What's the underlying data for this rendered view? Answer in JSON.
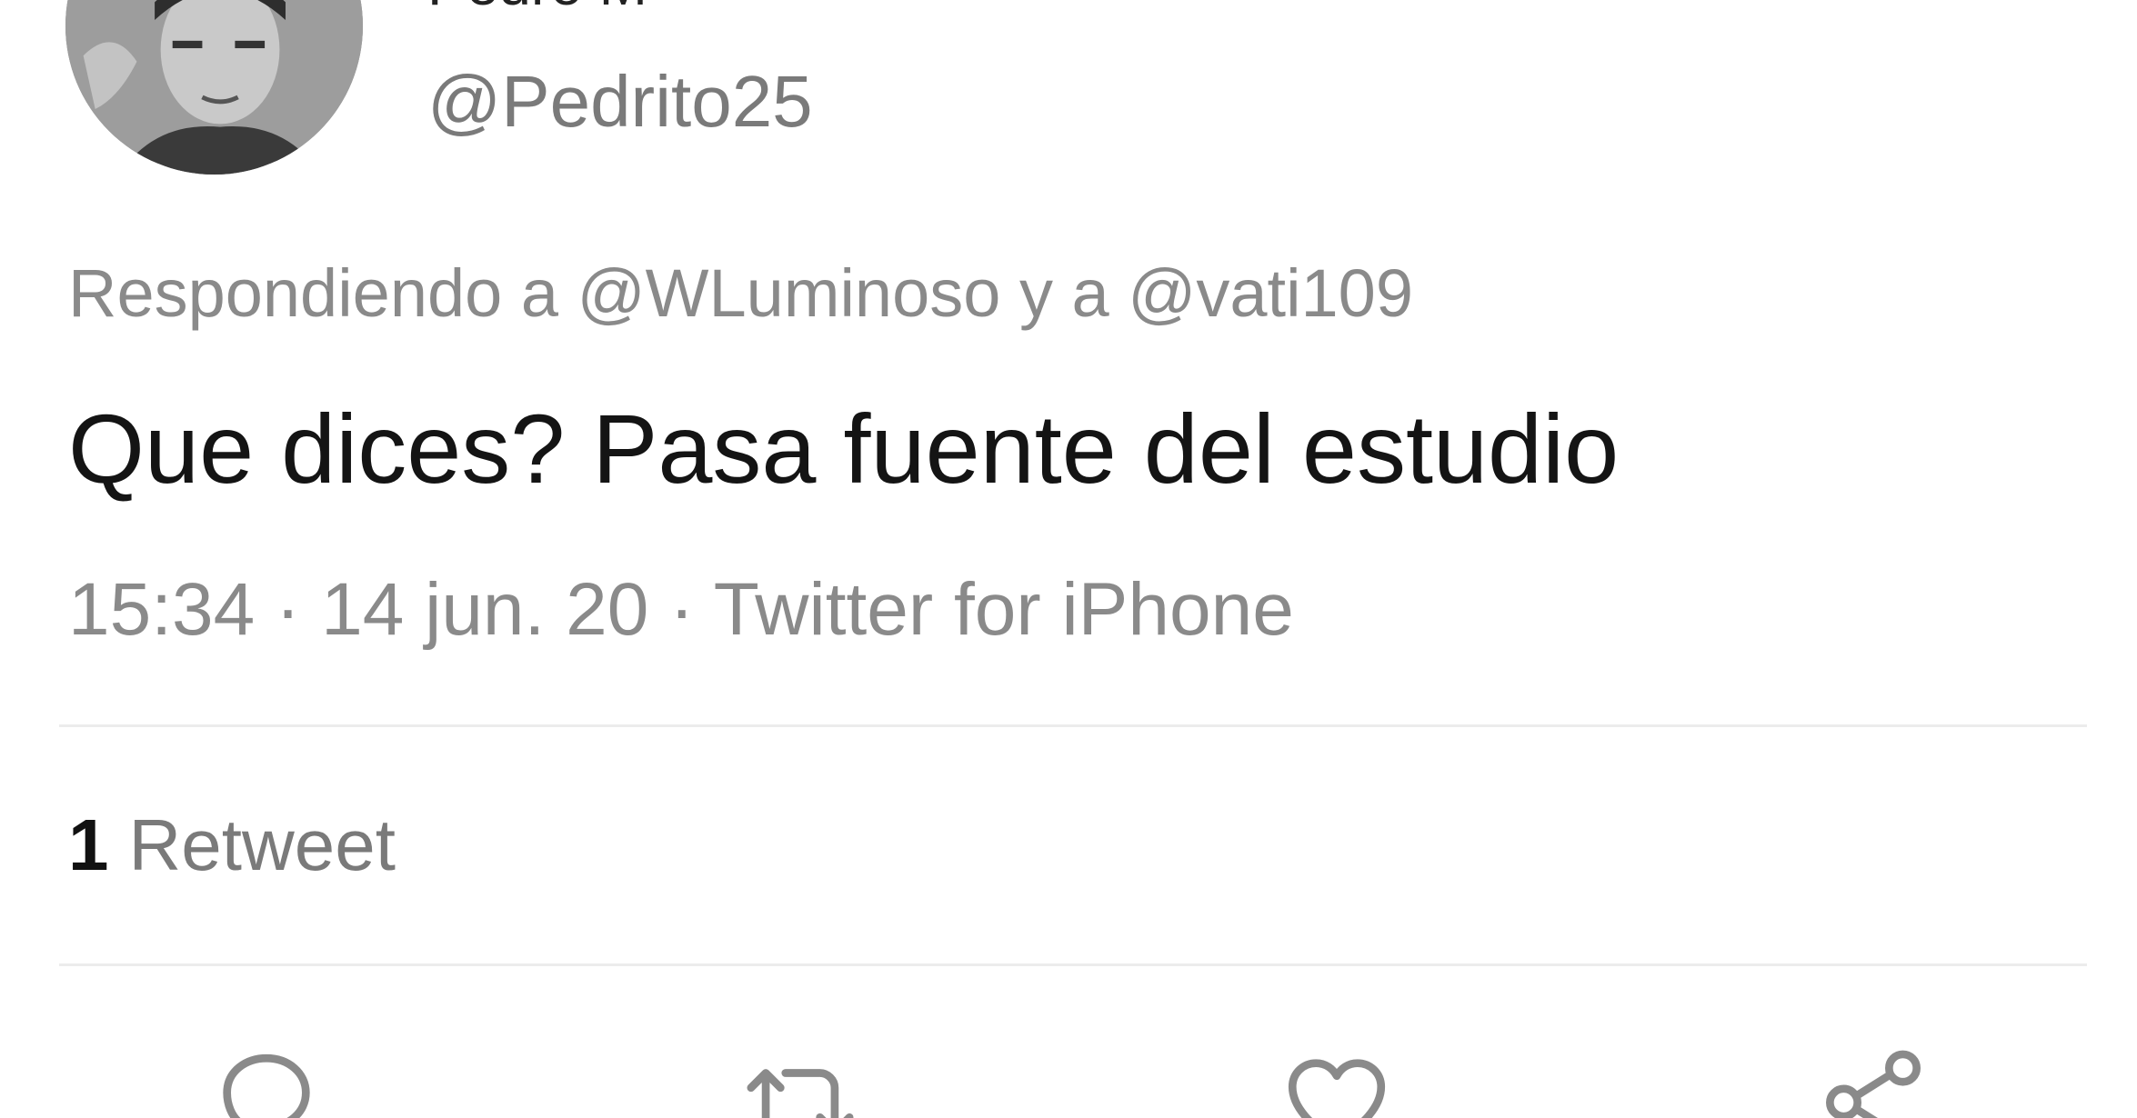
{
  "tweet": {
    "display_name": "Pedro M",
    "handle": "@Pedrito25",
    "replying_to": {
      "prefix": "Respondiendo a",
      "user1": "@WLuminoso",
      "connector": "y a",
      "user2": "@vati109"
    },
    "text": "Que dices? Pasa fuente del estudio",
    "time": "15:34",
    "date": "14 jun. 20",
    "source": "Twitter for iPhone",
    "separator": "·",
    "retweet_count": "1",
    "retweet_label": "Retweet"
  },
  "actions": [
    {
      "name": "reply",
      "icon": "reply-icon"
    },
    {
      "name": "retweet",
      "icon": "retweet-icon"
    },
    {
      "name": "like",
      "icon": "heart-icon"
    },
    {
      "name": "share",
      "icon": "share-icon"
    }
  ],
  "colors": {
    "text_primary": "#141414",
    "text_secondary": "#8a8a8a",
    "divider": "#ececec",
    "icon": "#8a8a8a"
  }
}
